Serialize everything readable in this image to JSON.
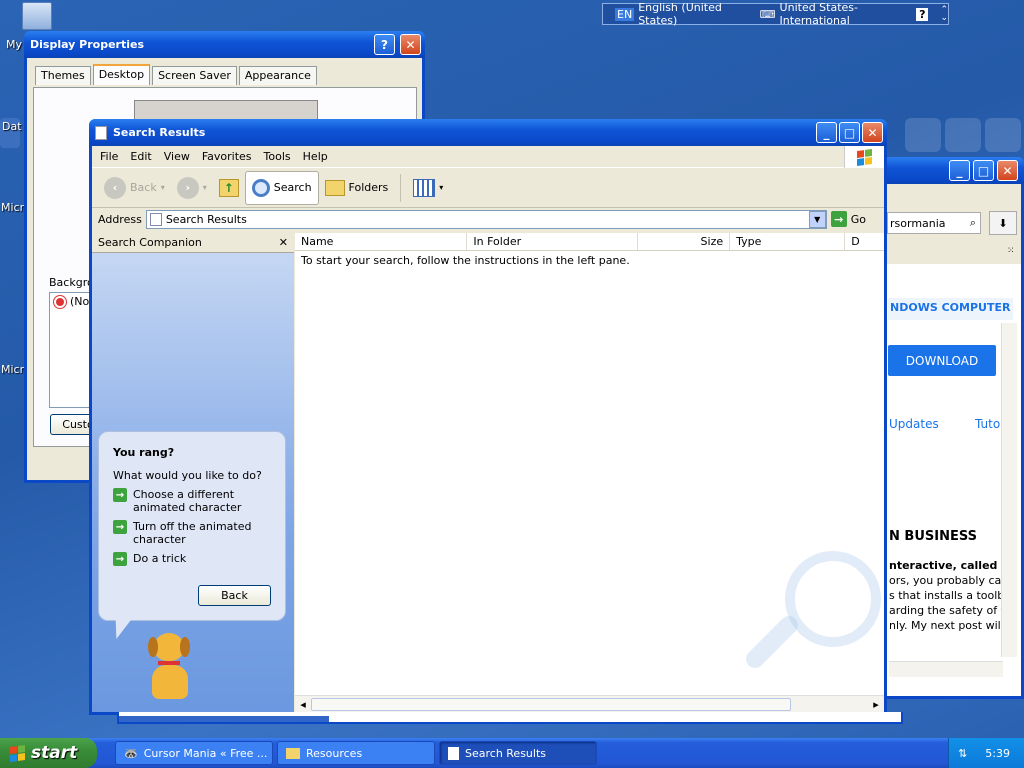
{
  "desktop": {
    "icons": [
      {
        "label": "My"
      },
      {
        "label": "Dat"
      },
      {
        "label": "Micr"
      },
      {
        "label": "Micr"
      }
    ]
  },
  "langbar": {
    "code": "EN",
    "language": "English (United States)",
    "keyboard": "United States-International"
  },
  "display_properties": {
    "title": "Display Properties",
    "tabs": [
      "Themes",
      "Desktop",
      "Screen Saver",
      "Appearance"
    ],
    "active_tab": "Desktop",
    "background_label": "Backgrou",
    "list_item": "(No",
    "customize_button": "Custo"
  },
  "browser_bg": {
    "search_text": "rsormania",
    "banner": "NDOWS COMPUTER M",
    "download": "DOWNLOAD",
    "links": [
      "Updates",
      "Tutori"
    ],
    "heading": "N BUSINESS",
    "body_bold": "nteractive, called Cur",
    "body_lines": [
      "ors, you probably can",
      "s that installs a toolba",
      "arding the safety of th",
      "nly. My next post will c"
    ]
  },
  "search_window": {
    "title": "Search Results",
    "menu": [
      "File",
      "Edit",
      "View",
      "Favorites",
      "Tools",
      "Help"
    ],
    "toolbar": {
      "back": "Back",
      "search": "Search",
      "folders": "Folders"
    },
    "address_label": "Address",
    "address_value": "Search Results",
    "go_label": "Go",
    "companion_title": "Search Companion",
    "bubble": {
      "title": "You rang?",
      "prompt": "What would you like to do?",
      "choices": [
        "Choose a different animated character",
        "Turn off the animated character",
        "Do a trick"
      ],
      "back_button": "Back"
    },
    "columns": [
      "Name",
      "In Folder",
      "Size",
      "Type",
      "D"
    ],
    "empty_message": "To start your search, follow the instructions in the left pane."
  },
  "taskbar": {
    "start": "start",
    "tasks": [
      "Cursor Mania « Free ...",
      "Resources",
      "Search Results"
    ],
    "active_task": "Search Results",
    "clock": "5:39"
  },
  "colors": {
    "xp_blue": "#0a48c8",
    "start_green": "#3a8d3a",
    "download_blue": "#1a73e8"
  }
}
